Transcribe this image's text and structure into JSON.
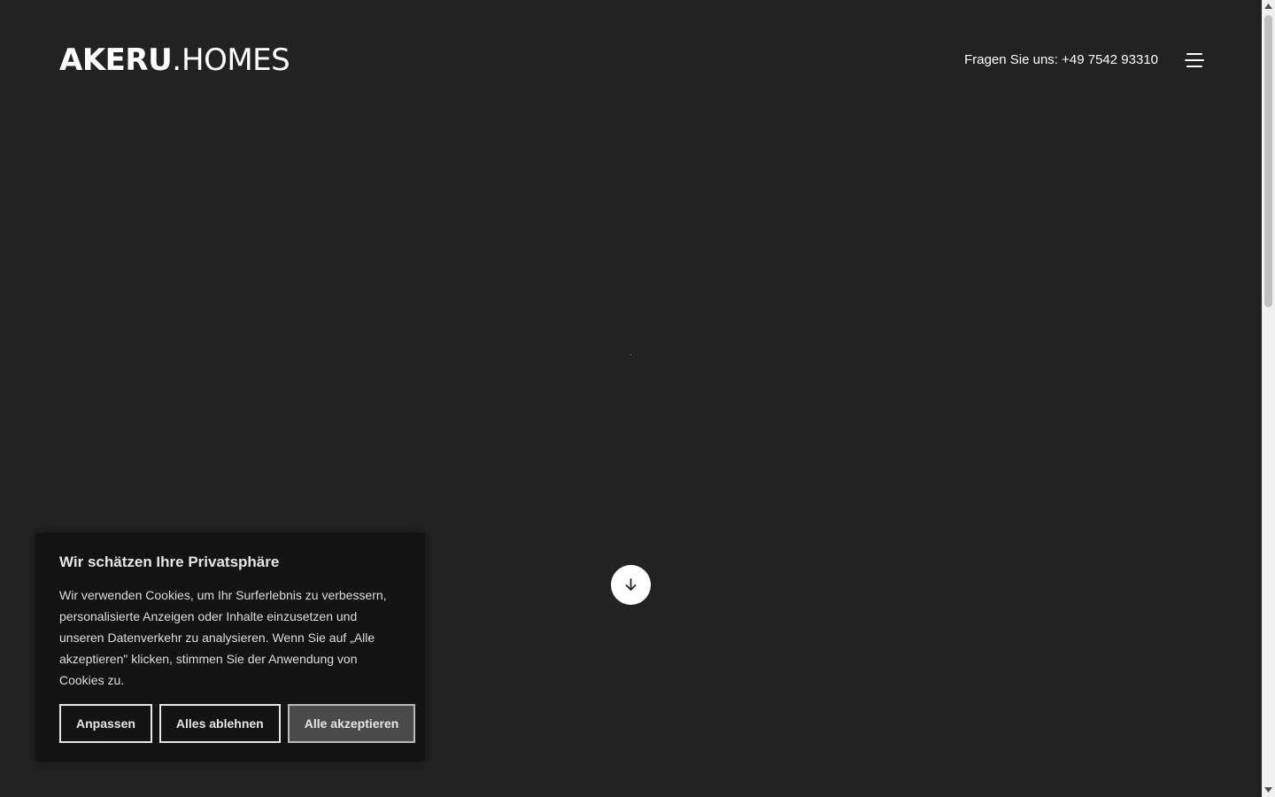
{
  "header": {
    "logo_bold": "AKERU",
    "logo_dot": ".",
    "logo_light": "HOMES",
    "contact_text": "Fragen Sie uns: +49 7542 93310"
  },
  "icons": {
    "menu": "hamburger-menu-icon",
    "scroll_down": "arrow-down-icon"
  },
  "cookie_banner": {
    "title": "Wir schätzen Ihre Privatsphäre",
    "text": "Wir verwenden Cookies, um Ihr Surferlebnis zu verbessern, personalisierte Anzeigen oder Inhalte einzusetzen und unseren Datenverkehr zu analysieren. Wenn Sie auf „Alle akzeptieren\" klicken, stimmen Sie der Anwendung von Cookies zu.",
    "customize_label": "Anpassen",
    "reject_label": "Alles ablehnen",
    "accept_label": "Alle akzeptieren"
  },
  "colors": {
    "background": "#222222",
    "banner_background": "#131313",
    "text": "#ffffff",
    "accept_button": "#4a4a4a"
  }
}
